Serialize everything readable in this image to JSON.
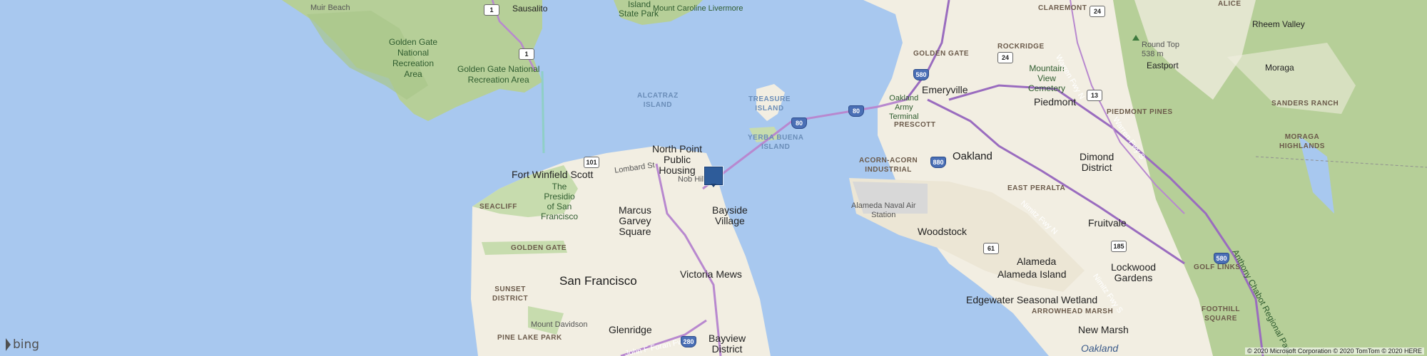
{
  "map": {
    "provider": "bing",
    "copyright": "© 2020 Microsoft Corporation © 2020 TomTom © 2020 HERE",
    "marker_color": "#2e5c9a",
    "colors": {
      "water": "#a8c8ef",
      "land": "#f2eee2",
      "park": "#c7dcae",
      "hills": "#b6cf98",
      "highway": "#b888cf",
      "freeway": "#9a6cbf"
    }
  },
  "labels": {
    "muir_beach": "Muir Beach",
    "sausalito": "Sausalito",
    "angel_island": "Island",
    "angel_island_sp": "State Park",
    "mount_caroline": "Mount Caroline Livermore",
    "golden_gate_nra_1": "Golden Gate",
    "golden_gate_nra_2": "National",
    "golden_gate_nra_3": "Recreation",
    "golden_gate_nra_4": "Area",
    "golden_gate_nra_b1": "Golden Gate National",
    "golden_gate_nra_b2": "Recreation Area",
    "alcatraz_1": "ALCATRAZ",
    "alcatraz_2": "ISLAND",
    "treasure_1": "TREASURE",
    "treasure_2": "ISLAND",
    "yerba_1": "YERBA BUENA",
    "yerba_2": "ISLAND",
    "north_point_1": "North Point",
    "north_point_2": "Public",
    "north_point_3": "Housing",
    "nob_hill": "Nob Hill",
    "fort_winfield": "Fort Winfield Scott",
    "presidio_1": "The",
    "presidio_2": "Presidio",
    "presidio_3": "of San",
    "presidio_4": "Francisco",
    "lombard": "Lombard St",
    "seacliff": "SEACLIFF",
    "marcus_1": "Marcus",
    "marcus_2": "Garvey",
    "marcus_3": "Square",
    "bayside_1": "Bayside",
    "bayside_2": "Village",
    "golden_gate_park": "GOLDEN GATE",
    "san_francisco": "San Francisco",
    "sunset_1": "SUNSET",
    "sunset_2": "DISTRICT",
    "victoria_mews": "Victoria Mews",
    "mount_davidson": "Mount Davidson",
    "glenridge": "Glenridge",
    "pine_lake": "PINE LAKE PARK",
    "john_foran": "John F Foran Fwy",
    "bayview_1": "Bayview",
    "bayview_2": "District",
    "golden_gate_east": "GOLDEN GATE",
    "claremont": "CLAREMONT",
    "rockridge": "ROCKRIDGE",
    "mountain_view_1": "Mountain",
    "mountain_view_2": "View",
    "mountain_view_3": "Cemetery",
    "emeryville": "Emeryville",
    "oakland_army_1": "Oakland",
    "oakland_army_2": "Army",
    "oakland_army_3": "Terminal",
    "prescott": "PRESCOTT",
    "piedmont": "Piedmont",
    "acorn_1": "ACORN-ACORN",
    "acorn_2": "INDUSTRIAL",
    "oakland": "Oakland",
    "east_peralta": "EAST PERALTA",
    "alameda_naval_1": "Alameda Naval Air",
    "alameda_naval_2": "Station",
    "woodstock": "Woodstock",
    "alameda": "Alameda",
    "alameda_island": "Alameda Island",
    "edgewater": "Edgewater Seasonal Wetland",
    "arrowhead": "ARROWHEAD MARSH",
    "new_marsh": "New Marsh",
    "oakland_airport": "Oakland",
    "fruitvale": "Fruitvale",
    "dimond_1": "Dimond",
    "dimond_2": "District",
    "lockwood_1": "Lockwood",
    "lockwood_2": "Gardens",
    "alice": "ALICE",
    "rheem": "Rheem Valley",
    "round_top_1": "Round Top",
    "round_top_2": "538 m",
    "eastport": "Eastport",
    "moraga": "Moraga",
    "sanders": "SANDERS RANCH",
    "piedmont_pines": "PIEDMONT PINES",
    "moraga_high_1": "MORAGA",
    "moraga_high_2": "HIGHLANDS",
    "anthony_chabot": "Anthony Chabot Regional Park",
    "golf_links": "GOLF LINKS",
    "foothill_1": "FOOTHILL",
    "foothill_2": "SQUARE",
    "warren_fwy_n": "Warren Fwy N",
    "warren_fwy_s": "Warren Fwy S",
    "nimitz_n": "Nimitz Fwy N",
    "nimitz_n2": "Nimitz Fwy S"
  },
  "shields": {
    "r1a": "1",
    "r1b": "1",
    "r101": "101",
    "i80a": "80",
    "i80b": "80",
    "i580a": "580",
    "r24a": "24",
    "r24b": "24",
    "r13": "13",
    "i880": "880",
    "r61": "61",
    "r185": "185",
    "i580b": "580",
    "i280": "280"
  },
  "branding": {
    "logo_text": "bing"
  }
}
